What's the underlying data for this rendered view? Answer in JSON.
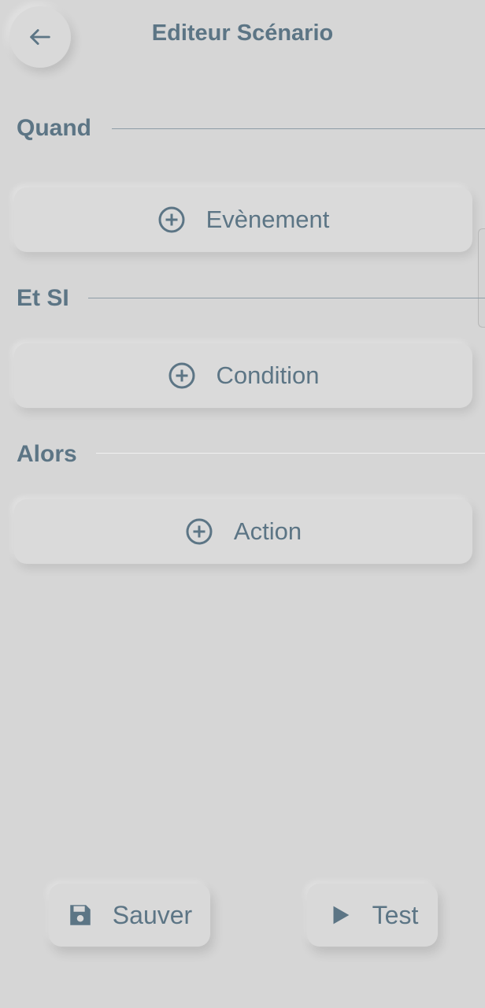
{
  "header": {
    "title": "Editeur Scénario",
    "back_icon": "arrow-left-icon"
  },
  "sections": {
    "when": {
      "label": "Quand",
      "add_label": "Evènement",
      "add_icon": "add-circle-icon"
    },
    "and_if": {
      "label": "Et SI",
      "add_label": "Condition",
      "add_icon": "add-circle-icon"
    },
    "then": {
      "label": "Alors",
      "add_label": "Action",
      "add_icon": "add-circle-icon"
    }
  },
  "footer": {
    "save_label": "Sauver",
    "save_icon": "floppy-disk-icon",
    "test_label": "Test",
    "test_icon": "play-icon"
  },
  "colors": {
    "background": "#d6d6d6",
    "text": "#5c7585",
    "divider": "#8d9ca6"
  }
}
